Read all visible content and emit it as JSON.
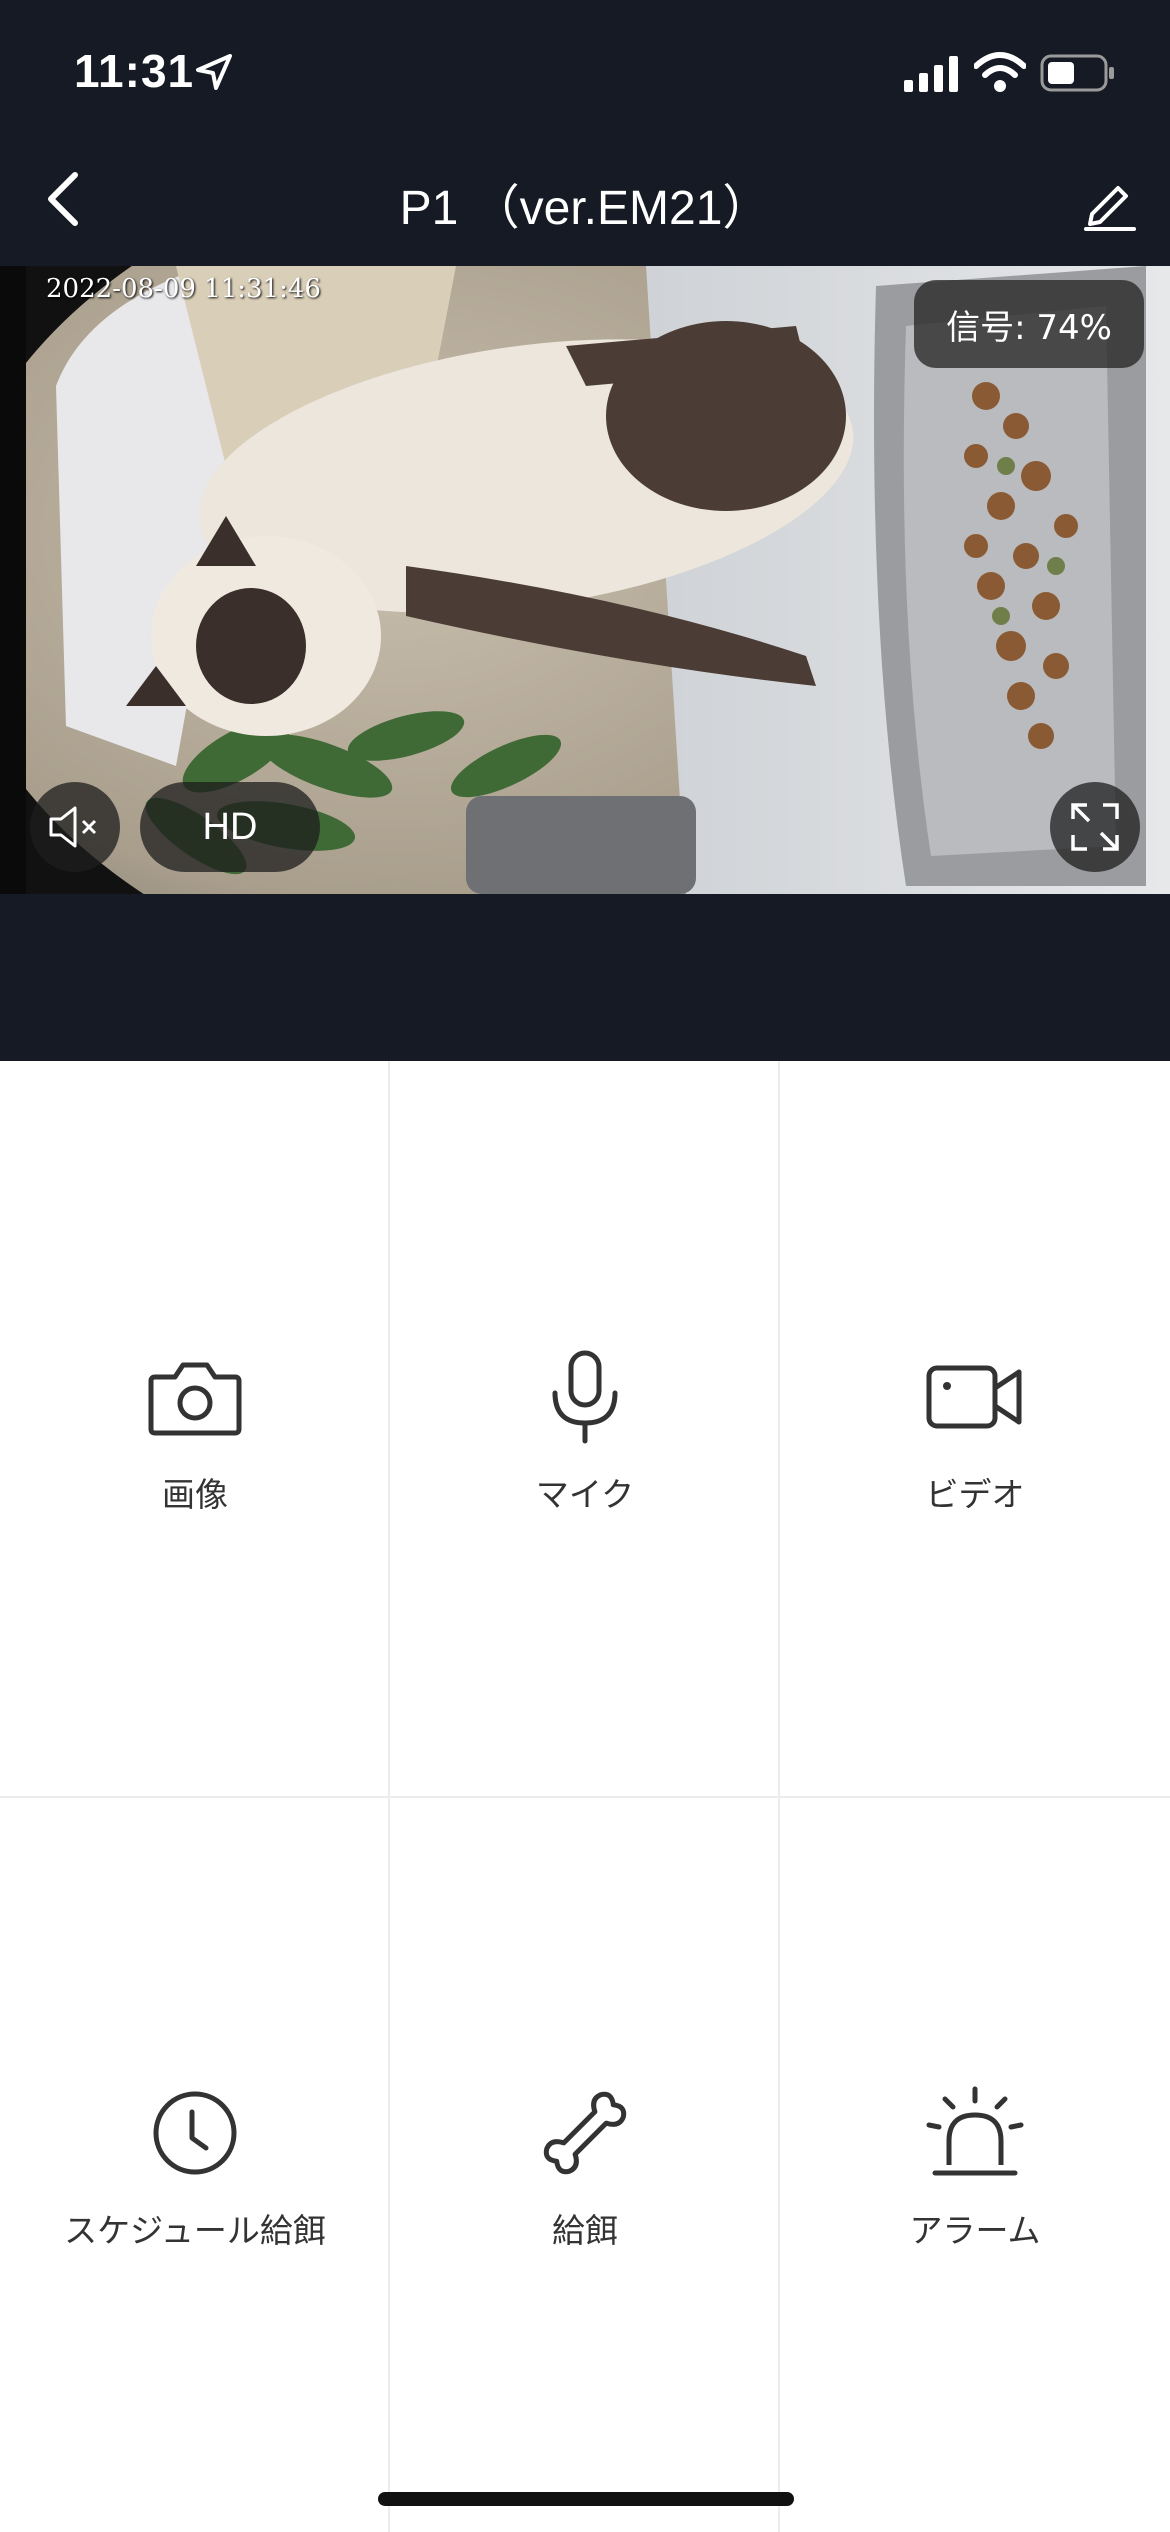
{
  "status_bar": {
    "time": "11:31"
  },
  "nav": {
    "title": "P1 （ver.EM21）"
  },
  "video": {
    "timestamp": "2022-08-09 11:31:46",
    "signal": "信号: 74%",
    "quality": "HD"
  },
  "actions": [
    {
      "label": "画像",
      "icon": "camera-icon"
    },
    {
      "label": "マイク",
      "icon": "microphone-icon"
    },
    {
      "label": "ビデオ",
      "icon": "video-camera-icon"
    },
    {
      "label": "スケジュール給餌",
      "icon": "clock-icon"
    },
    {
      "label": "給餌",
      "icon": "bone-icon"
    },
    {
      "label": "アラーム",
      "icon": "alarm-siren-icon"
    }
  ],
  "colors": {
    "header_bg": "#161a24",
    "icon": "#333333"
  }
}
